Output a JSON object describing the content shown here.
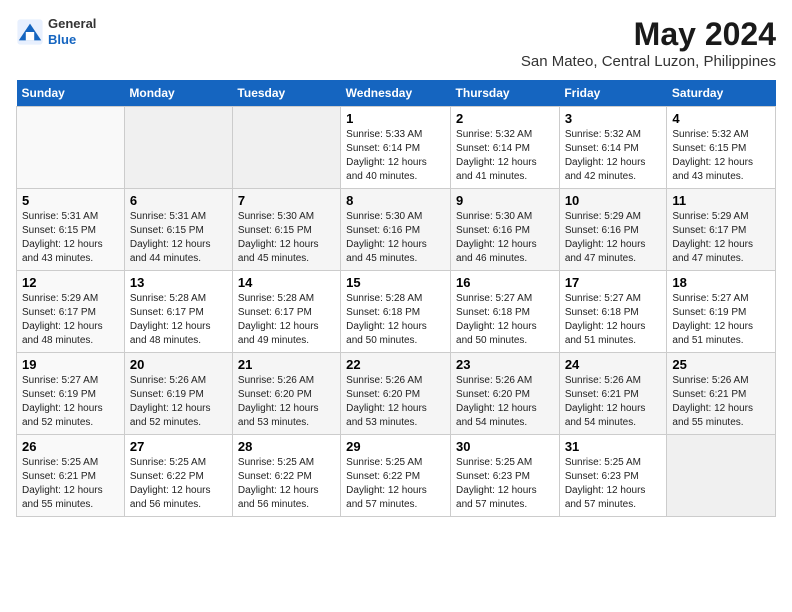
{
  "header": {
    "logo_general": "General",
    "logo_blue": "Blue",
    "title": "May 2024",
    "subtitle": "San Mateo, Central Luzon, Philippines"
  },
  "calendar": {
    "days_of_week": [
      "Sunday",
      "Monday",
      "Tuesday",
      "Wednesday",
      "Thursday",
      "Friday",
      "Saturday"
    ],
    "weeks": [
      [
        {
          "day": "",
          "info": ""
        },
        {
          "day": "",
          "info": ""
        },
        {
          "day": "",
          "info": ""
        },
        {
          "day": "1",
          "info": "Sunrise: 5:33 AM\nSunset: 6:14 PM\nDaylight: 12 hours\nand 40 minutes."
        },
        {
          "day": "2",
          "info": "Sunrise: 5:32 AM\nSunset: 6:14 PM\nDaylight: 12 hours\nand 41 minutes."
        },
        {
          "day": "3",
          "info": "Sunrise: 5:32 AM\nSunset: 6:14 PM\nDaylight: 12 hours\nand 42 minutes."
        },
        {
          "day": "4",
          "info": "Sunrise: 5:32 AM\nSunset: 6:15 PM\nDaylight: 12 hours\nand 43 minutes."
        }
      ],
      [
        {
          "day": "5",
          "info": "Sunrise: 5:31 AM\nSunset: 6:15 PM\nDaylight: 12 hours\nand 43 minutes."
        },
        {
          "day": "6",
          "info": "Sunrise: 5:31 AM\nSunset: 6:15 PM\nDaylight: 12 hours\nand 44 minutes."
        },
        {
          "day": "7",
          "info": "Sunrise: 5:30 AM\nSunset: 6:15 PM\nDaylight: 12 hours\nand 45 minutes."
        },
        {
          "day": "8",
          "info": "Sunrise: 5:30 AM\nSunset: 6:16 PM\nDaylight: 12 hours\nand 45 minutes."
        },
        {
          "day": "9",
          "info": "Sunrise: 5:30 AM\nSunset: 6:16 PM\nDaylight: 12 hours\nand 46 minutes."
        },
        {
          "day": "10",
          "info": "Sunrise: 5:29 AM\nSunset: 6:16 PM\nDaylight: 12 hours\nand 47 minutes."
        },
        {
          "day": "11",
          "info": "Sunrise: 5:29 AM\nSunset: 6:17 PM\nDaylight: 12 hours\nand 47 minutes."
        }
      ],
      [
        {
          "day": "12",
          "info": "Sunrise: 5:29 AM\nSunset: 6:17 PM\nDaylight: 12 hours\nand 48 minutes."
        },
        {
          "day": "13",
          "info": "Sunrise: 5:28 AM\nSunset: 6:17 PM\nDaylight: 12 hours\nand 48 minutes."
        },
        {
          "day": "14",
          "info": "Sunrise: 5:28 AM\nSunset: 6:17 PM\nDaylight: 12 hours\nand 49 minutes."
        },
        {
          "day": "15",
          "info": "Sunrise: 5:28 AM\nSunset: 6:18 PM\nDaylight: 12 hours\nand 50 minutes."
        },
        {
          "day": "16",
          "info": "Sunrise: 5:27 AM\nSunset: 6:18 PM\nDaylight: 12 hours\nand 50 minutes."
        },
        {
          "day": "17",
          "info": "Sunrise: 5:27 AM\nSunset: 6:18 PM\nDaylight: 12 hours\nand 51 minutes."
        },
        {
          "day": "18",
          "info": "Sunrise: 5:27 AM\nSunset: 6:19 PM\nDaylight: 12 hours\nand 51 minutes."
        }
      ],
      [
        {
          "day": "19",
          "info": "Sunrise: 5:27 AM\nSunset: 6:19 PM\nDaylight: 12 hours\nand 52 minutes."
        },
        {
          "day": "20",
          "info": "Sunrise: 5:26 AM\nSunset: 6:19 PM\nDaylight: 12 hours\nand 52 minutes."
        },
        {
          "day": "21",
          "info": "Sunrise: 5:26 AM\nSunset: 6:20 PM\nDaylight: 12 hours\nand 53 minutes."
        },
        {
          "day": "22",
          "info": "Sunrise: 5:26 AM\nSunset: 6:20 PM\nDaylight: 12 hours\nand 53 minutes."
        },
        {
          "day": "23",
          "info": "Sunrise: 5:26 AM\nSunset: 6:20 PM\nDaylight: 12 hours\nand 54 minutes."
        },
        {
          "day": "24",
          "info": "Sunrise: 5:26 AM\nSunset: 6:21 PM\nDaylight: 12 hours\nand 54 minutes."
        },
        {
          "day": "25",
          "info": "Sunrise: 5:26 AM\nSunset: 6:21 PM\nDaylight: 12 hours\nand 55 minutes."
        }
      ],
      [
        {
          "day": "26",
          "info": "Sunrise: 5:25 AM\nSunset: 6:21 PM\nDaylight: 12 hours\nand 55 minutes."
        },
        {
          "day": "27",
          "info": "Sunrise: 5:25 AM\nSunset: 6:22 PM\nDaylight: 12 hours\nand 56 minutes."
        },
        {
          "day": "28",
          "info": "Sunrise: 5:25 AM\nSunset: 6:22 PM\nDaylight: 12 hours\nand 56 minutes."
        },
        {
          "day": "29",
          "info": "Sunrise: 5:25 AM\nSunset: 6:22 PM\nDaylight: 12 hours\nand 57 minutes."
        },
        {
          "day": "30",
          "info": "Sunrise: 5:25 AM\nSunset: 6:23 PM\nDaylight: 12 hours\nand 57 minutes."
        },
        {
          "day": "31",
          "info": "Sunrise: 5:25 AM\nSunset: 6:23 PM\nDaylight: 12 hours\nand 57 minutes."
        },
        {
          "day": "",
          "info": ""
        }
      ]
    ]
  }
}
